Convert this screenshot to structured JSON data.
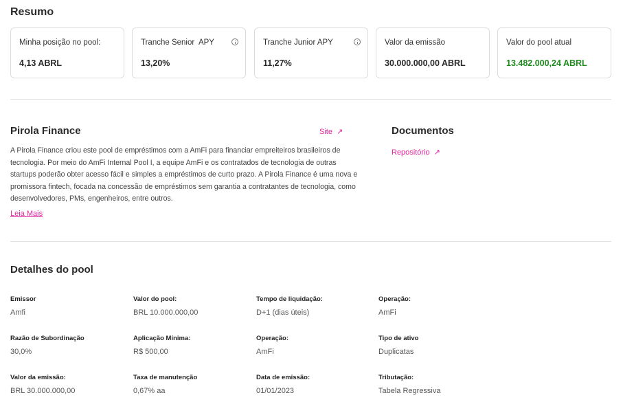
{
  "resumo": {
    "title": "Resumo",
    "cards": [
      {
        "label": "Minha posição no pool:",
        "value": "4,13 ABRL",
        "info": false
      },
      {
        "label": "Tranche Senior  APY",
        "value": "13,20%",
        "info": true
      },
      {
        "label": "Tranche Junior APY",
        "value": "11,27%",
        "info": true
      },
      {
        "label": "Valor da emissão",
        "value": "30.000.000,00 ABRL",
        "info": false
      },
      {
        "label": "Valor do pool atual",
        "value": "13.482.000,24 ABRL",
        "info": false,
        "color": "#1e8a1e"
      }
    ]
  },
  "about": {
    "title": "Pirola Finance",
    "site_label": "Site",
    "description": "A Pirola Finance criou este pool de empréstimos com a AmFi para financiar empreiteiros brasileiros de tecnologia. Por meio do AmFi Internal Pool I, a equipe AmFi e os contratados de tecnologia de outras startups poderão obter acesso fácil e simples a empréstimos de curto prazo. A Pirola Finance é uma nova e promissora fintech, focada na concessão de empréstimos sem garantia a contratantes de tecnologia, como desenvolvedores, PMs, engenheiros, entre outros.",
    "read_more": "Leia Mais"
  },
  "documents": {
    "title": "Documentos",
    "repo_label": "Repositório"
  },
  "details": {
    "title": "Detalhes do pool",
    "rows": [
      [
        {
          "k": "Emissor",
          "v": "Amfi"
        },
        {
          "k": "Valor do pool:",
          "v": "BRL 10.000.000,00"
        },
        {
          "k": "Tempo de liquidação:",
          "v": "D+1 (dias úteis)"
        },
        {
          "k": "Operação:",
          "v": "AmFi"
        }
      ],
      [
        {
          "k": "Razão de Subordinação",
          "v": "30,0%"
        },
        {
          "k": "Aplicação Mínima:",
          "v": "R$ 500,00"
        },
        {
          "k": "Operação:",
          "v": "AmFi"
        },
        {
          "k": "Tipo de ativo",
          "v": "Duplicatas"
        }
      ],
      [
        {
          "k": "Valor da emissão:",
          "v": "BRL 30.000.000,00"
        },
        {
          "k": "Taxa de manutenção",
          "v": "0,67% aa"
        },
        {
          "k": "Data de emissão:",
          "v": "01/01/2023"
        },
        {
          "k": "Tributação:",
          "v": "Tabela Regressiva"
        }
      ]
    ]
  },
  "colors": {
    "accent": "#e0249a",
    "positive": "#1e8a1e",
    "border": "#dcdcdc"
  }
}
